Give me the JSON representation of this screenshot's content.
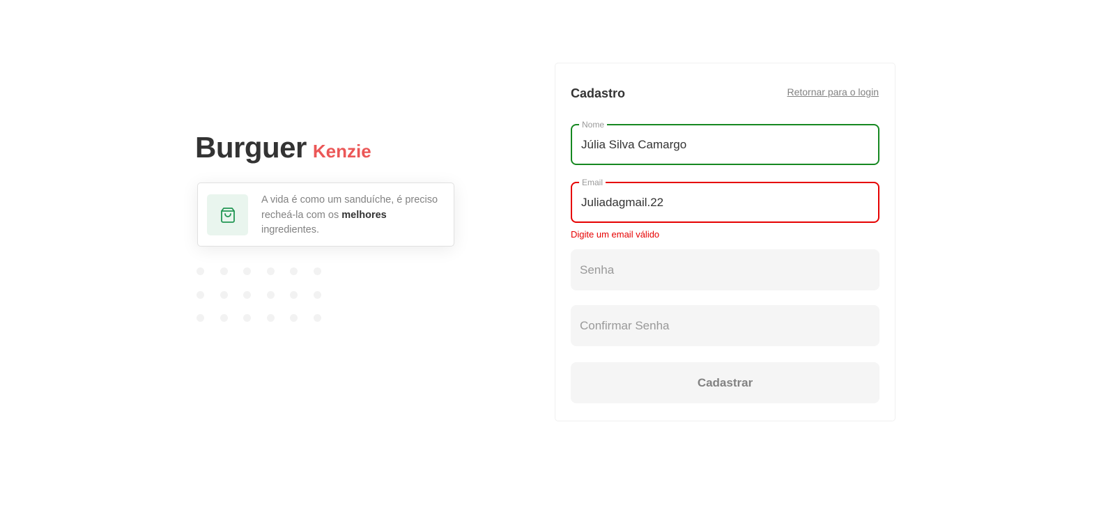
{
  "brand": {
    "name": "Burguer",
    "accent": "Kenzie"
  },
  "quote": {
    "icon": "shopping-bag-icon",
    "before": "A vida é como um sanduíche, é preciso recheá-la com os ",
    "bold": "melhores",
    "after": " ingredientes."
  },
  "form": {
    "title": "Cadastro",
    "back_link": "Retornar para o login",
    "name": {
      "label": "Nome",
      "value": "Júlia Silva Camargo"
    },
    "email": {
      "label": "Email",
      "value": "Juliadagmail.22",
      "error": "Digite um email válido"
    },
    "password": {
      "placeholder": "Senha"
    },
    "confirm_password": {
      "placeholder": "Confirmar Senha"
    },
    "submit_label": "Cadastrar"
  },
  "colors": {
    "accent_red": "#EB5757",
    "success_green": "#168821",
    "error_red": "#E60000",
    "icon_green": "#219653"
  }
}
